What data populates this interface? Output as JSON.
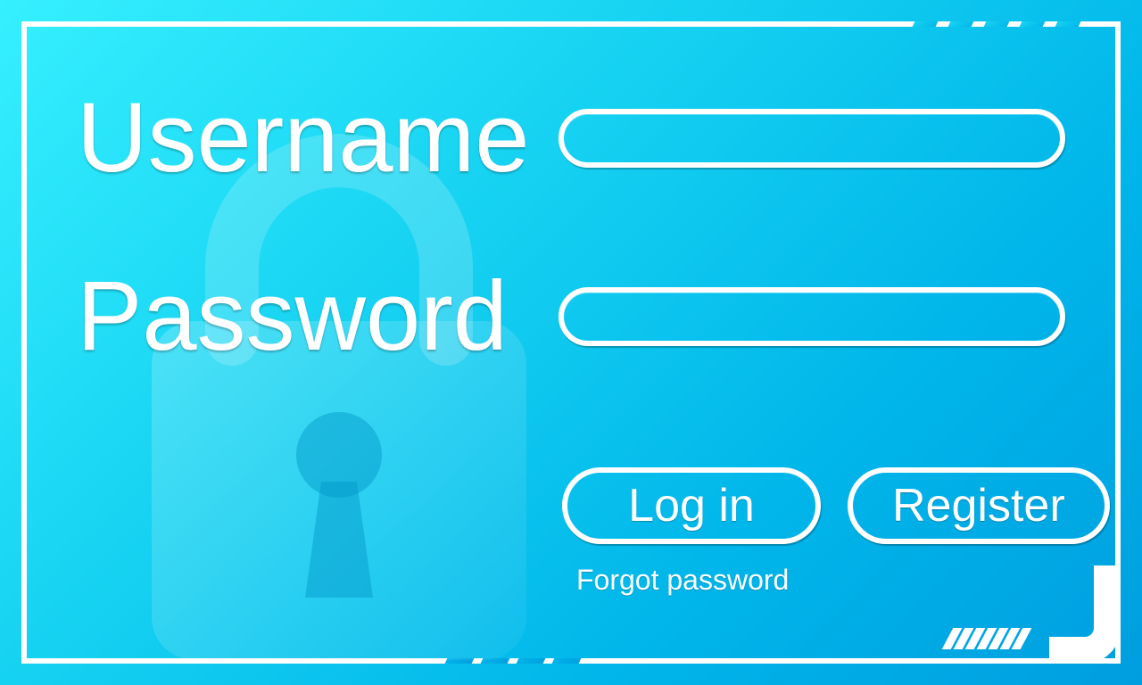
{
  "form": {
    "username_label": "Username",
    "password_label": "Password",
    "username_value": "",
    "password_value": ""
  },
  "buttons": {
    "login": "Log in",
    "register": "Register"
  },
  "links": {
    "forgot": "Forgot password"
  },
  "icons": {
    "lock": "lock-icon"
  },
  "colors": {
    "accent": "#00b6ea",
    "border": "#ffffff"
  }
}
